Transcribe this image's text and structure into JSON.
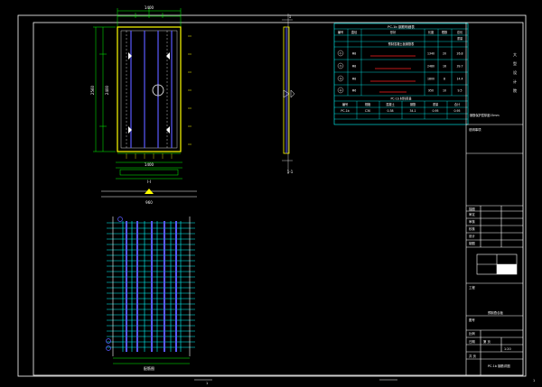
{
  "drawing": {
    "background": "#000000",
    "colors": {
      "frame": "#ffffff",
      "outline": "#ffff00",
      "dimension": "#00ff00",
      "rebar": "#5a5aff",
      "stirrup": "#00ffff",
      "table": "#00ffff",
      "highlight": "#ff2020",
      "text": "#ffffff"
    },
    "plan_view": {
      "dim_top": "1400",
      "dim_bottom": "1400",
      "dim_section": "I-I",
      "dim_width_label": "960",
      "dim_left": "2560",
      "dim_left_inner": "2400"
    },
    "section_view": {
      "label_top": "1",
      "label_bottom": "1-1"
    },
    "rebar_view": {
      "label_bottom": "配筋图"
    },
    "schedule_table": {
      "title": "PC-1b 钢筋明细表",
      "header_row": [
        "编号",
        "直径",
        "形状",
        "长度",
        "根数",
        "总长",
        "重量"
      ],
      "section_title": "预制混凝土板钢筋表",
      "rows": [
        [
          "①",
          "Φ8",
          "",
          "1340",
          "20",
          "26.8",
          "10.6"
        ],
        [
          "②",
          "Φ8",
          "",
          "2480",
          "16",
          "39.7",
          "15.7"
        ],
        [
          "③",
          "Φ8",
          "",
          "1800",
          "8",
          "14.4",
          "5.7"
        ],
        [
          "④",
          "Φ6",
          "",
          "950",
          "10",
          "9.5",
          "2.1"
        ]
      ],
      "summary_title": "PC-1b 材料用量",
      "summary_header": [
        "编号",
        "规格",
        "混凝土",
        "钢筋",
        "重量",
        "合计"
      ],
      "summary_row": [
        "PC-1b",
        "C30",
        "0.38",
        "34.1",
        "0.95",
        "0.95"
      ],
      "note": "钢筋保护层厚度15mm"
    },
    "title_block": {
      "vertical_text": [
        "大",
        "型",
        "设",
        "计",
        "院"
      ],
      "note_label": "说明事项",
      "rows": [
        "审定",
        "审核",
        "校核",
        "设计",
        "制图",
        "描图"
      ],
      "project_label": "工程",
      "drawing_no_label": "图号",
      "scale_label": "比例",
      "scale_value": "1:20",
      "date_label": "日期",
      "sheet_label": "共 页",
      "sheet_value": "第 页",
      "drawing_title": "PC-1b 钢筋详图",
      "subtitle": "预制叠合板"
    },
    "footer_marks": [
      "1",
      "1"
    ]
  }
}
